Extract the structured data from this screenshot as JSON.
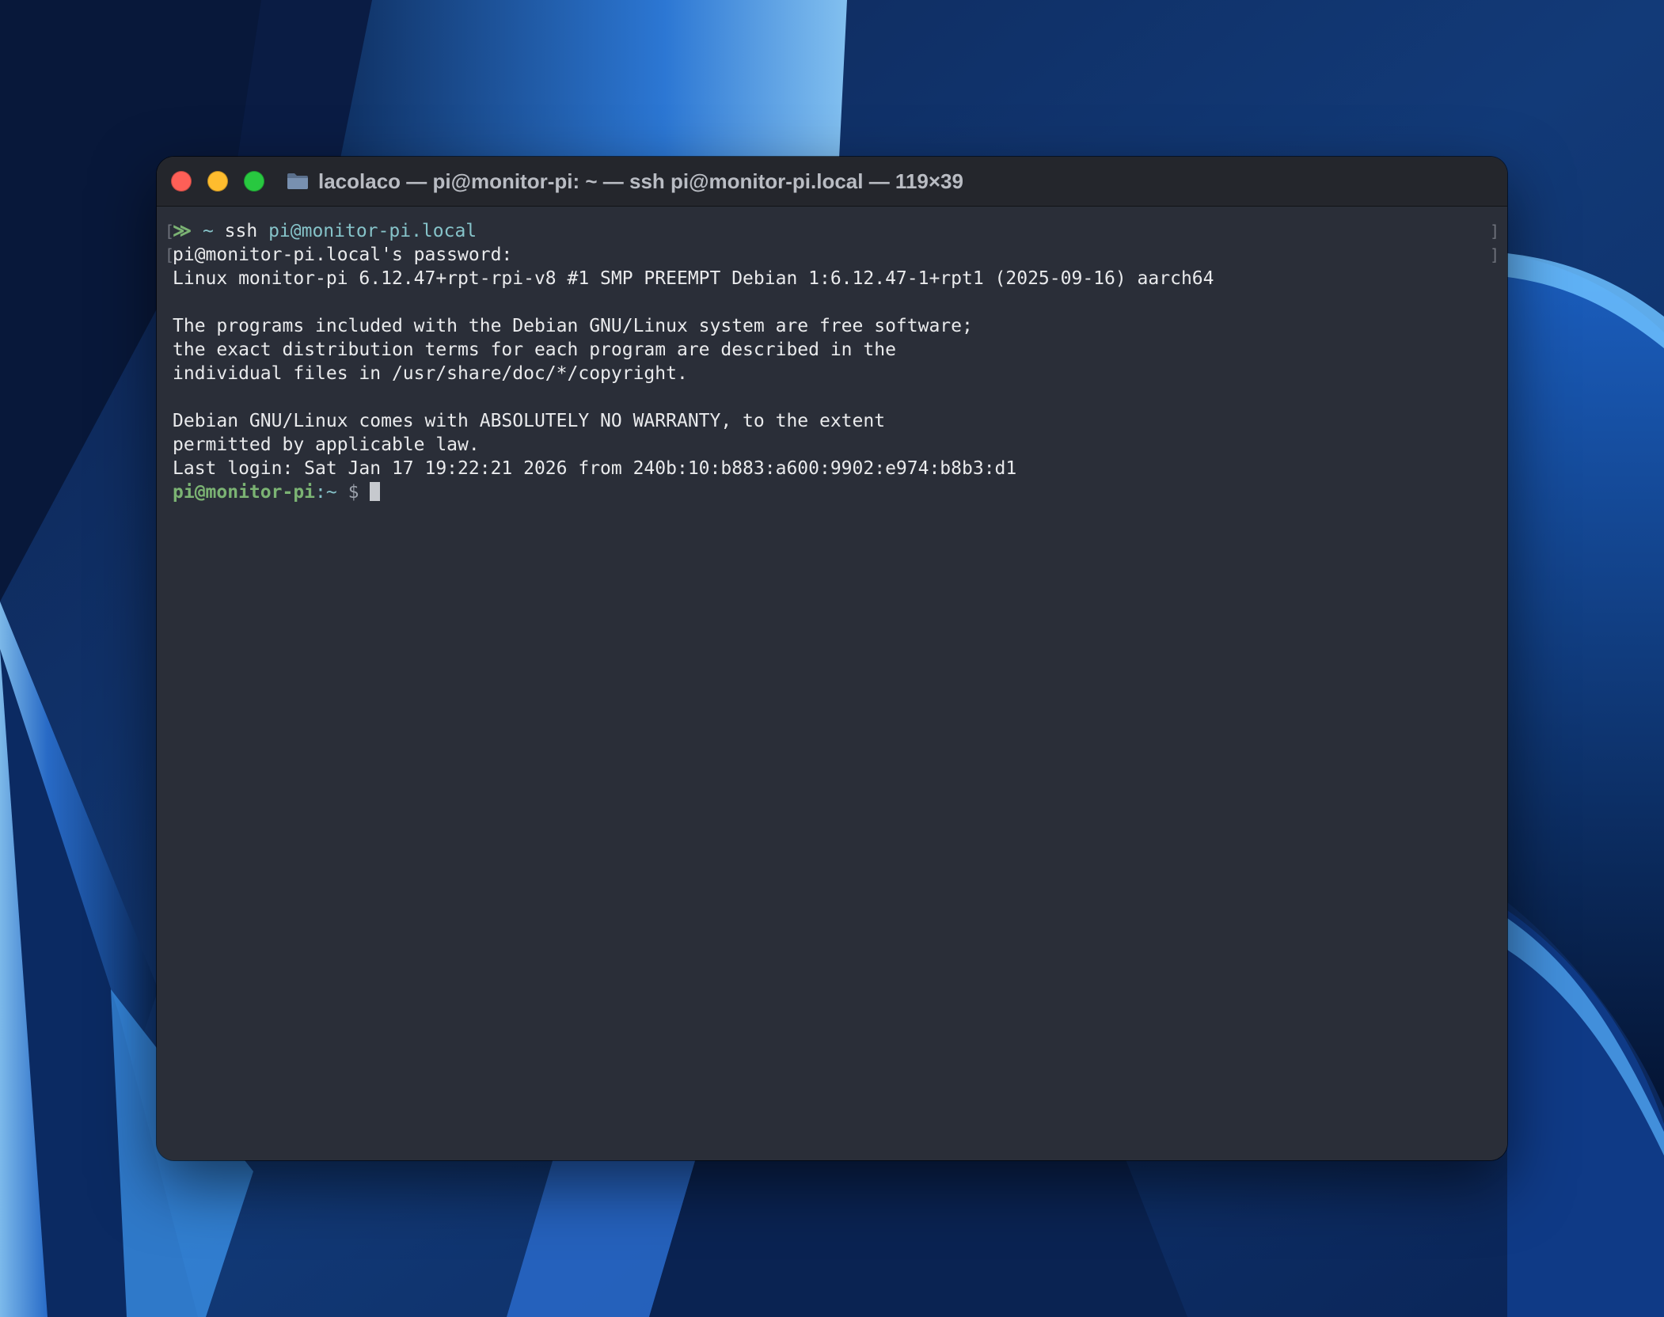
{
  "window": {
    "title": "lacolaco — pi@monitor-pi: ~ — ssh pi@monitor-pi.local — 119×39",
    "controls": [
      "close",
      "minimize",
      "zoom"
    ],
    "icon": "folder-icon"
  },
  "terminal": {
    "prompt_symbol": "≫",
    "prompt_dir": "~",
    "command": "ssh",
    "command_arg": "pi@monitor-pi.local",
    "password_prompt": "pi@monitor-pi.local's password:",
    "uname_line": "Linux monitor-pi 6.12.47+rpt-rpi-v8 #1 SMP PREEMPT Debian 1:6.12.47-1+rpt1 (2025-09-16) aarch64",
    "motd_1": "The programs included with the Debian GNU/Linux system are free software;",
    "motd_2": "the exact distribution terms for each program are described in the",
    "motd_3": "individual files in /usr/share/doc/*/copyright.",
    "warranty_1": "Debian GNU/Linux comes with ABSOLUTELY NO WARRANTY, to the extent",
    "warranty_2": "permitted by applicable law.",
    "last_login": "Last login: Sat Jan 17 19:22:21 2026 from 240b:10:b883:a600:9902:e974:b8b3:d1",
    "shell_user_host": "pi@monitor-pi",
    "shell_path": ":~",
    "shell_symbol": "$"
  },
  "colors": {
    "prompt_green": "#7bb373",
    "arg_cyan": "#86c3c9",
    "background": "#2a2e38",
    "titlebar": "#24262c"
  }
}
